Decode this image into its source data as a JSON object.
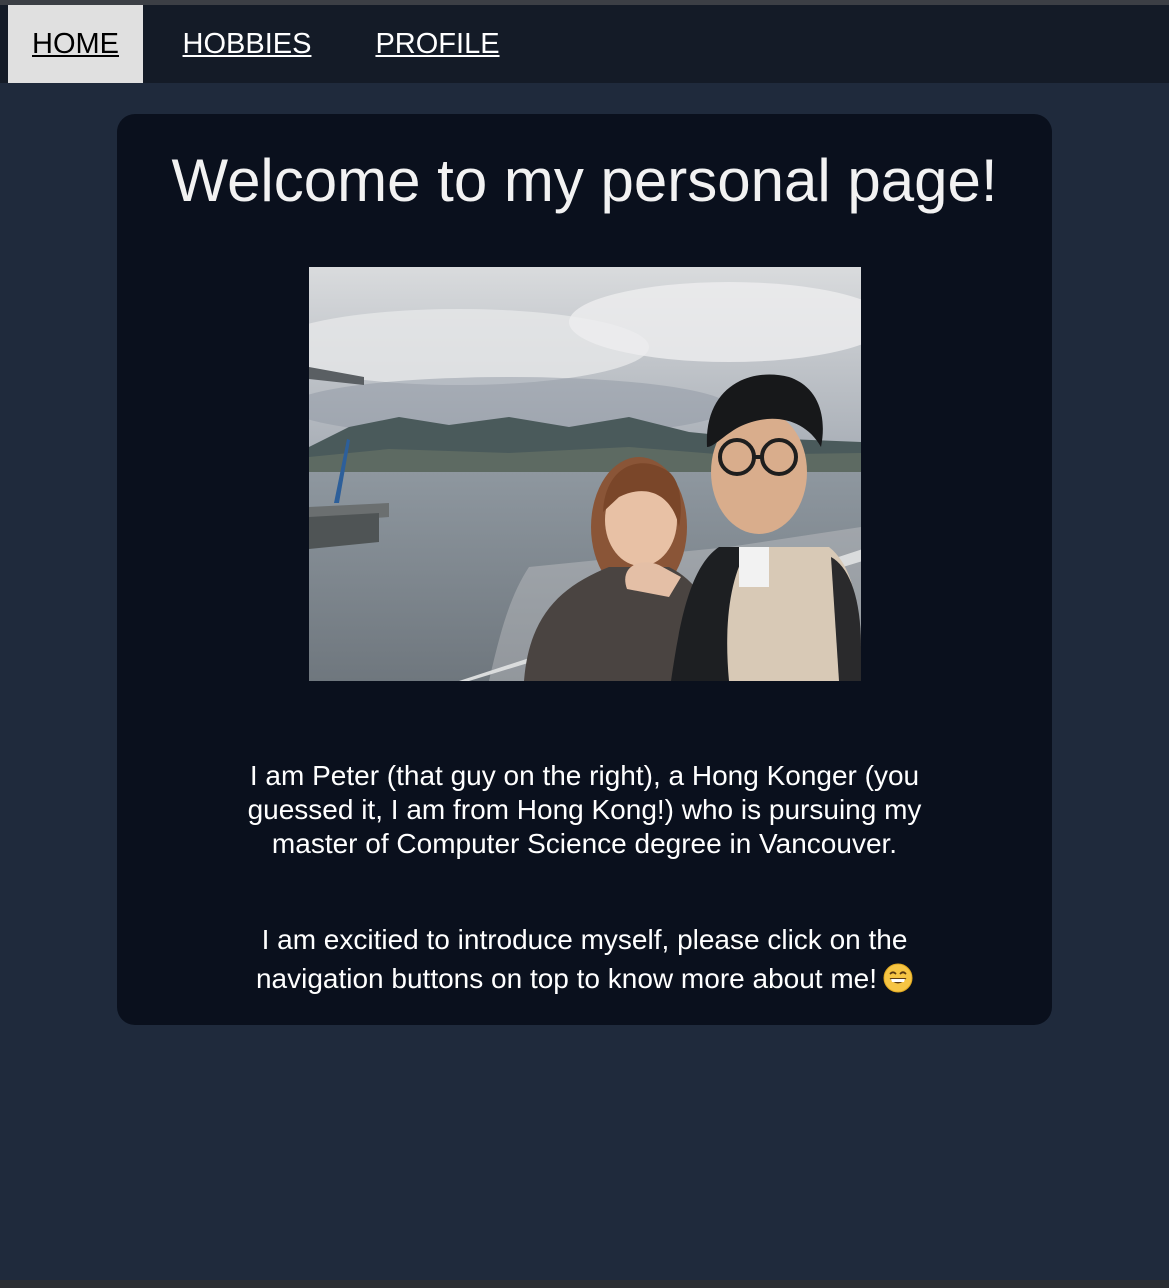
{
  "nav": {
    "items": [
      {
        "label": "HOME",
        "active": true
      },
      {
        "label": "HOBBIES",
        "active": false
      },
      {
        "label": "PROFILE",
        "active": false
      }
    ]
  },
  "main": {
    "title": "Welcome to my personal page!",
    "intro": "I am Peter (that guy on the right), a Hong Konger (you guessed it, I am from Hong Kong!) who is pursuing my master of Computer Science degree in Vancouver.",
    "cta": "I am excitied to introduce myself, please click on the navigation buttons on top to know more about me!",
    "emoji_icon": "grinning-face-icon"
  },
  "colors": {
    "page_bg": "#1f2a3c",
    "nav_bg": "#141b27",
    "card_bg": "#0a101d",
    "active_tab_bg": "#e0e0e0"
  }
}
